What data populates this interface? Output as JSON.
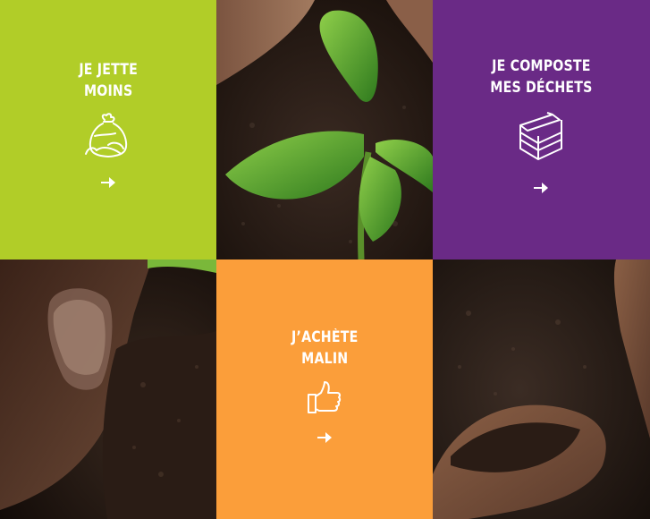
{
  "tiles": {
    "jette": {
      "line1": "JE JETTE",
      "line2": "MOINS",
      "icon": "garbage-bag-icon",
      "color": "#b1cd28"
    },
    "composte": {
      "line1": "JE COMPOSTE",
      "line2": "MES DÉCHETS",
      "icon": "compost-bin-icon",
      "color": "#6a2a86"
    },
    "achete": {
      "line1": "J’ACHÈTE",
      "line2": "MALIN",
      "icon": "thumbs-up-icon",
      "color": "#fb9e3a"
    }
  },
  "arrow_icon": "arrow-right-icon"
}
